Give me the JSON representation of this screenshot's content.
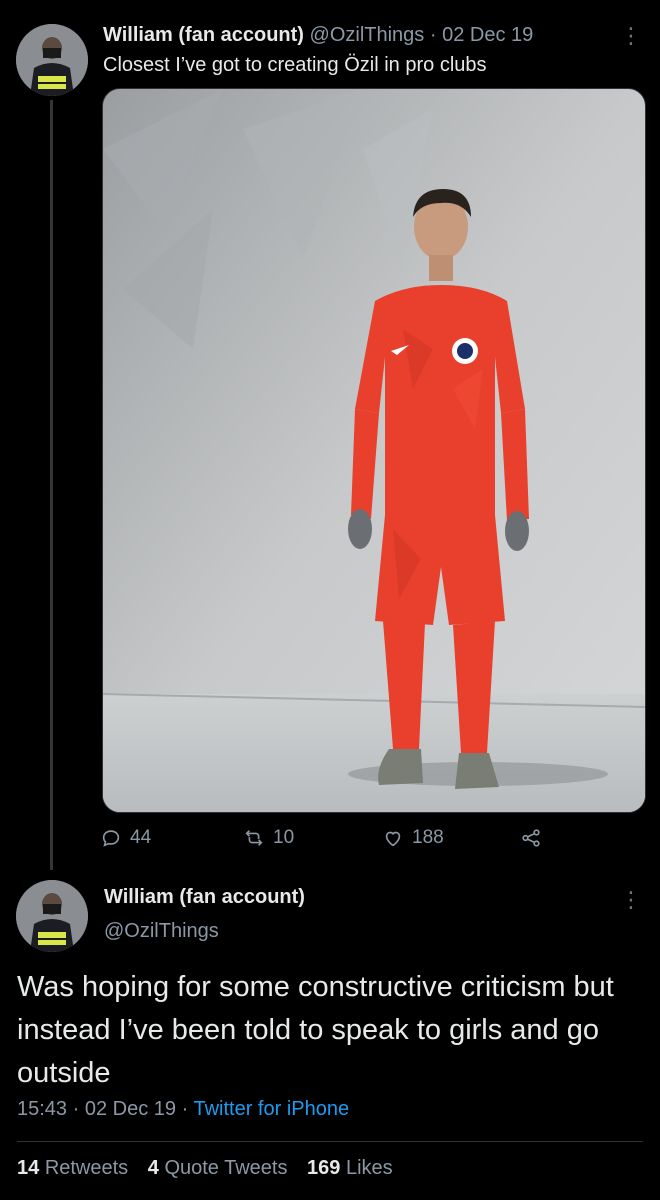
{
  "tweet1": {
    "name": "William (fan account)",
    "handle": "@OzilThings",
    "separator": "·",
    "date": "02 Dec 19",
    "text": "Closest I’ve got to creating Özil in pro clubs",
    "actions": {
      "replies": "44",
      "retweets": "10",
      "likes": "188"
    }
  },
  "tweet2": {
    "name": "William (fan account)",
    "handle": "@OzilThings",
    "text": "Was hoping for some constructive criticism but instead I’ve been told to speak to girls and go outside",
    "time": "15:43",
    "separator1": "·",
    "date": "02 Dec 19",
    "separator2": "·",
    "source": "Twitter for iPhone",
    "stats": {
      "retweets_count": "14",
      "retweets_label": "Retweets",
      "quotes_count": "4",
      "quotes_label": "Quote Tweets",
      "likes_count": "169",
      "likes_label": "Likes"
    }
  },
  "colors": {
    "background": "#000000",
    "text": "#e7e9ea",
    "muted": "#8b98a5",
    "link": "#1d9bf0",
    "kit_red": "#e8402c"
  },
  "icons": [
    "avatar",
    "more-icon",
    "reply-icon",
    "retweet-icon",
    "like-icon",
    "share-icon"
  ]
}
